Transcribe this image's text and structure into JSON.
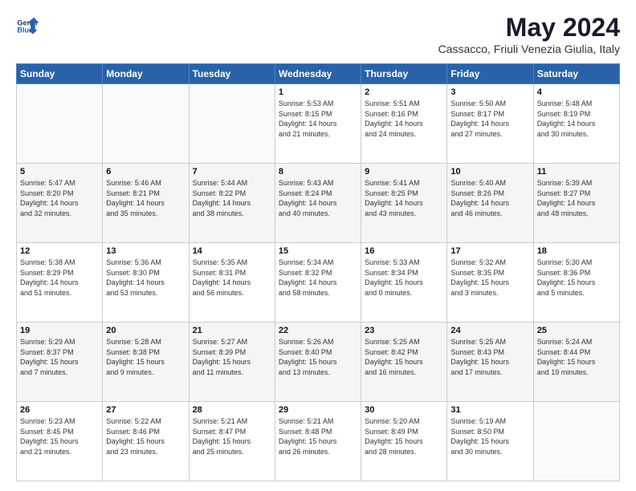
{
  "logo": {
    "line1": "General",
    "line2": "Blue"
  },
  "title": "May 2024",
  "subtitle": "Cassacco, Friuli Venezia Giulia, Italy",
  "days_header": [
    "Sunday",
    "Monday",
    "Tuesday",
    "Wednesday",
    "Thursday",
    "Friday",
    "Saturday"
  ],
  "weeks": [
    [
      {
        "day": "",
        "info": ""
      },
      {
        "day": "",
        "info": ""
      },
      {
        "day": "",
        "info": ""
      },
      {
        "day": "1",
        "info": "Sunrise: 5:53 AM\nSunset: 8:15 PM\nDaylight: 14 hours\nand 21 minutes."
      },
      {
        "day": "2",
        "info": "Sunrise: 5:51 AM\nSunset: 8:16 PM\nDaylight: 14 hours\nand 24 minutes."
      },
      {
        "day": "3",
        "info": "Sunrise: 5:50 AM\nSunset: 8:17 PM\nDaylight: 14 hours\nand 27 minutes."
      },
      {
        "day": "4",
        "info": "Sunrise: 5:48 AM\nSunset: 8:19 PM\nDaylight: 14 hours\nand 30 minutes."
      }
    ],
    [
      {
        "day": "5",
        "info": "Sunrise: 5:47 AM\nSunset: 8:20 PM\nDaylight: 14 hours\nand 32 minutes."
      },
      {
        "day": "6",
        "info": "Sunrise: 5:46 AM\nSunset: 8:21 PM\nDaylight: 14 hours\nand 35 minutes."
      },
      {
        "day": "7",
        "info": "Sunrise: 5:44 AM\nSunset: 8:22 PM\nDaylight: 14 hours\nand 38 minutes."
      },
      {
        "day": "8",
        "info": "Sunrise: 5:43 AM\nSunset: 8:24 PM\nDaylight: 14 hours\nand 40 minutes."
      },
      {
        "day": "9",
        "info": "Sunrise: 5:41 AM\nSunset: 8:25 PM\nDaylight: 14 hours\nand 43 minutes."
      },
      {
        "day": "10",
        "info": "Sunrise: 5:40 AM\nSunset: 8:26 PM\nDaylight: 14 hours\nand 46 minutes."
      },
      {
        "day": "11",
        "info": "Sunrise: 5:39 AM\nSunset: 8:27 PM\nDaylight: 14 hours\nand 48 minutes."
      }
    ],
    [
      {
        "day": "12",
        "info": "Sunrise: 5:38 AM\nSunset: 8:29 PM\nDaylight: 14 hours\nand 51 minutes."
      },
      {
        "day": "13",
        "info": "Sunrise: 5:36 AM\nSunset: 8:30 PM\nDaylight: 14 hours\nand 53 minutes."
      },
      {
        "day": "14",
        "info": "Sunrise: 5:35 AM\nSunset: 8:31 PM\nDaylight: 14 hours\nand 56 minutes."
      },
      {
        "day": "15",
        "info": "Sunrise: 5:34 AM\nSunset: 8:32 PM\nDaylight: 14 hours\nand 58 minutes."
      },
      {
        "day": "16",
        "info": "Sunrise: 5:33 AM\nSunset: 8:34 PM\nDaylight: 15 hours\nand 0 minutes."
      },
      {
        "day": "17",
        "info": "Sunrise: 5:32 AM\nSunset: 8:35 PM\nDaylight: 15 hours\nand 3 minutes."
      },
      {
        "day": "18",
        "info": "Sunrise: 5:30 AM\nSunset: 8:36 PM\nDaylight: 15 hours\nand 5 minutes."
      }
    ],
    [
      {
        "day": "19",
        "info": "Sunrise: 5:29 AM\nSunset: 8:37 PM\nDaylight: 15 hours\nand 7 minutes."
      },
      {
        "day": "20",
        "info": "Sunrise: 5:28 AM\nSunset: 8:38 PM\nDaylight: 15 hours\nand 9 minutes."
      },
      {
        "day": "21",
        "info": "Sunrise: 5:27 AM\nSunset: 8:39 PM\nDaylight: 15 hours\nand 11 minutes."
      },
      {
        "day": "22",
        "info": "Sunrise: 5:26 AM\nSunset: 8:40 PM\nDaylight: 15 hours\nand 13 minutes."
      },
      {
        "day": "23",
        "info": "Sunrise: 5:25 AM\nSunset: 8:42 PM\nDaylight: 15 hours\nand 16 minutes."
      },
      {
        "day": "24",
        "info": "Sunrise: 5:25 AM\nSunset: 8:43 PM\nDaylight: 15 hours\nand 17 minutes."
      },
      {
        "day": "25",
        "info": "Sunrise: 5:24 AM\nSunset: 8:44 PM\nDaylight: 15 hours\nand 19 minutes."
      }
    ],
    [
      {
        "day": "26",
        "info": "Sunrise: 5:23 AM\nSunset: 8:45 PM\nDaylight: 15 hours\nand 21 minutes."
      },
      {
        "day": "27",
        "info": "Sunrise: 5:22 AM\nSunset: 8:46 PM\nDaylight: 15 hours\nand 23 minutes."
      },
      {
        "day": "28",
        "info": "Sunrise: 5:21 AM\nSunset: 8:47 PM\nDaylight: 15 hours\nand 25 minutes."
      },
      {
        "day": "29",
        "info": "Sunrise: 5:21 AM\nSunset: 8:48 PM\nDaylight: 15 hours\nand 26 minutes."
      },
      {
        "day": "30",
        "info": "Sunrise: 5:20 AM\nSunset: 8:49 PM\nDaylight: 15 hours\nand 28 minutes."
      },
      {
        "day": "31",
        "info": "Sunrise: 5:19 AM\nSunset: 8:50 PM\nDaylight: 15 hours\nand 30 minutes."
      },
      {
        "day": "",
        "info": ""
      }
    ]
  ]
}
